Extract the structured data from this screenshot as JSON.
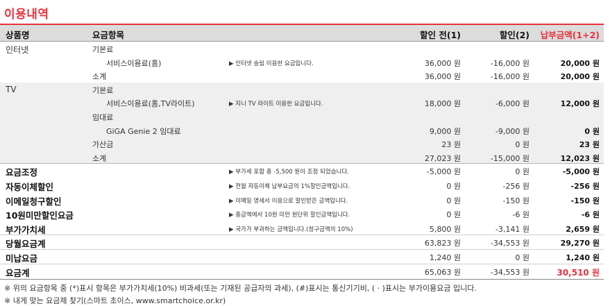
{
  "title": "이용내역",
  "headers": {
    "product": "상품명",
    "item": "요금항목",
    "before": "할인 전(1)",
    "discount": "할인(2)",
    "pay": "납부금액(1+2)"
  },
  "rows": [
    {
      "product": "인터넷",
      "item": "기본료",
      "sub": "",
      "desc": "",
      "before": "",
      "discount": "",
      "pay": ""
    },
    {
      "product": "",
      "item": "",
      "sub": "서비스이용료(홈)",
      "desc": "▶ 인터넷 슬림 이용한 요금입니다.",
      "before": "36,000 원",
      "discount": "-16,000 원",
      "pay": "20,000 원"
    },
    {
      "product": "",
      "item": "소계",
      "sub": "",
      "desc": "",
      "before": "36,000 원",
      "discount": "-16,000 원",
      "pay": "20,000 원"
    },
    {
      "product": "TV",
      "item": "기본료",
      "sub": "",
      "desc": "",
      "before": "",
      "discount": "",
      "pay": ""
    },
    {
      "product": "",
      "item": "",
      "sub": "서비스이용료(홈,TV라이트)",
      "desc": "▶ 지니 TV 라이트 이용한 요금입니다.",
      "before": "18,000 원",
      "discount": "-6,000 원",
      "pay": "12,000 원"
    },
    {
      "product": "",
      "item": "임대료",
      "sub": "",
      "desc": "",
      "before": "",
      "discount": "",
      "pay": ""
    },
    {
      "product": "",
      "item": "",
      "sub": "GiGA Genie 2 임대료",
      "desc": "",
      "before": "9,000 원",
      "discount": "-9,000 원",
      "pay": "0 원"
    },
    {
      "product": "",
      "item": "가산금",
      "sub": "",
      "desc": "",
      "before": "23 원",
      "discount": "0 원",
      "pay": "23 원"
    },
    {
      "product": "",
      "item": "소계",
      "sub": "",
      "desc": "",
      "before": "27,023 원",
      "discount": "-15,000 원",
      "pay": "12,023 원"
    }
  ],
  "summary": [
    {
      "label": "요금조정",
      "desc": "▶ 부가세 포함 총 -5,500 원이 조정 되었습니다.",
      "before": "-5,000 원",
      "discount": "0 원",
      "pay": "-5,000 원"
    },
    {
      "label": "자동이체할인",
      "desc": "▶ 전월 자동이체 납부요금의 1%할인금액입니다.",
      "before": "0 원",
      "discount": "-256 원",
      "pay": "-256 원"
    },
    {
      "label": "이메일청구할인",
      "desc": "▶ 이메일 명세서 이용으로 할인받은 금액입니다.",
      "before": "0 원",
      "discount": "-150 원",
      "pay": "-150 원"
    },
    {
      "label": "10원미만할인요금",
      "desc": "▶ 총금액에서 10원 미만 원단위 할인금액입니다.",
      "before": "0 원",
      "discount": "-6 원",
      "pay": "-6 원"
    },
    {
      "label": "부가가치세",
      "desc": "▶ 국가가 부과하는 금액입니다.(청구금액의 10%)",
      "before": "5,800 원",
      "discount": "-3,141 원",
      "pay": "2,659 원"
    },
    {
      "label": "당월요금계",
      "desc": "",
      "before": "63,823 원",
      "discount": "-34,553 원",
      "pay": "29,270 원"
    },
    {
      "label": "미납요금",
      "desc": "",
      "before": "1,240 원",
      "discount": "0 원",
      "pay": "1,240 원"
    },
    {
      "label": "요금계",
      "desc": "",
      "before": "65,063 원",
      "discount": "-34,553 원",
      "pay": "30,510 원"
    }
  ],
  "footnotes": [
    "※ 위의 요금항목 중 (*)표시 항목은 부가가치세(10%) 비과세(또는 기재된 공급자의 과세), (#)표시는 통신기기비, ( · )표시는 부가이용요금 입니다.",
    "※ 내게 맞는 요금제 찾기(스마트 초이스, www.smartchoice.or.kr)"
  ],
  "colors": {
    "accent": "#e8323c",
    "header_bg": "#dcdcdc",
    "section_bg": "#efefef"
  }
}
